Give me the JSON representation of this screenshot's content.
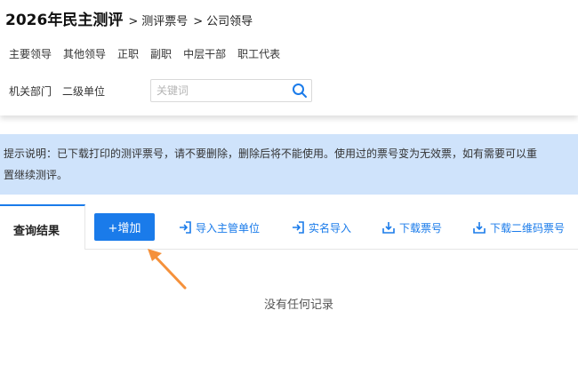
{
  "header": {
    "app_title": "2026年民主测评",
    "breadcrumb": [
      {
        "sep": ">",
        "label": "测评票号"
      },
      {
        "sep": ">",
        "label": "公司领导"
      }
    ]
  },
  "categories": [
    "主要领导",
    "其他领导",
    "正职",
    "副职",
    "中层干部",
    "职工代表"
  ],
  "departments": [
    "机关部门",
    "二级单位"
  ],
  "search": {
    "placeholder": "关键词",
    "value": ""
  },
  "notice": {
    "line1": "提示说明：已下载打印的测评票号，请不要删除，删除后将不能使用。使用过的票号变为无效票，如有需要可以重",
    "line2": "置继续测评。"
  },
  "tabs": {
    "active": "查询结果"
  },
  "toolbar": {
    "add_label": "+增加",
    "actions": [
      {
        "label": "导入主管单位",
        "icon": "import-icon"
      },
      {
        "label": "实名导入",
        "icon": "import-icon"
      },
      {
        "label": "下载票号",
        "icon": "download-icon"
      },
      {
        "label": "下载二维码票号",
        "icon": "download-icon"
      }
    ]
  },
  "empty_state": "没有任何记录",
  "colors": {
    "accent": "#1a7bea",
    "notice_bg": "#cfe3fb",
    "arrow": "#f5913b"
  }
}
